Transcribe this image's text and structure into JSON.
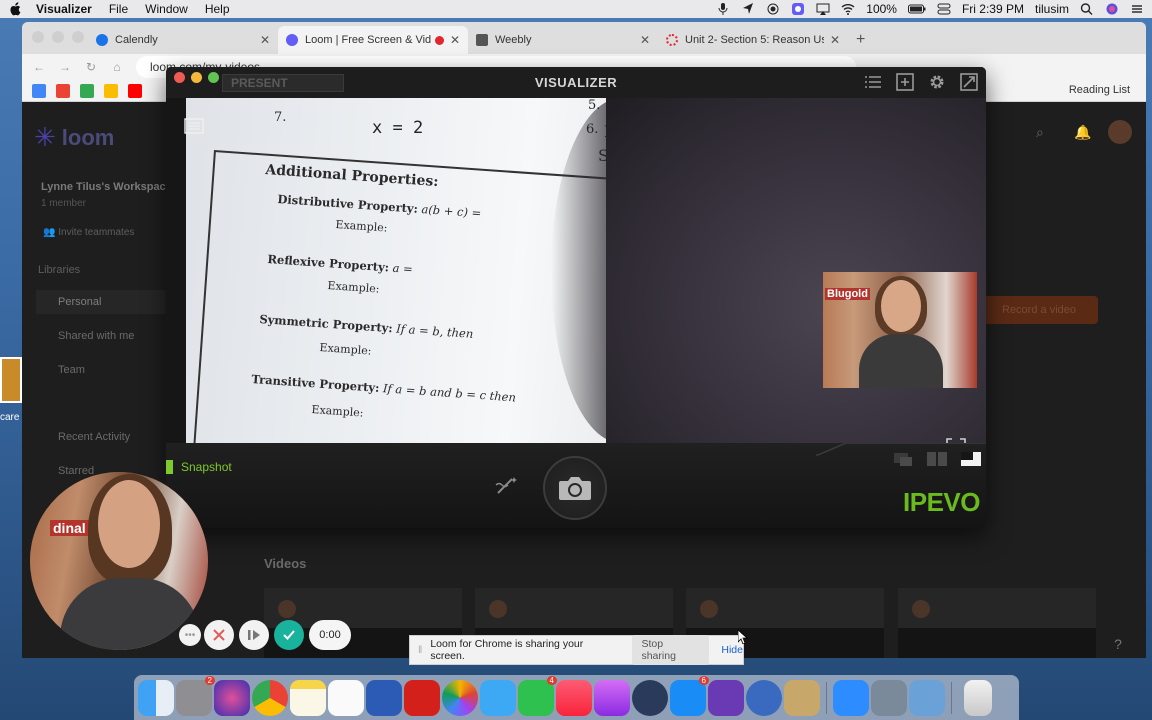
{
  "menubar": {
    "app": "Visualizer",
    "items": [
      "File",
      "Window",
      "Help"
    ],
    "battery": "100%",
    "clock": "Fri 2:39 PM",
    "user": "tilusim"
  },
  "browser": {
    "tabs": [
      {
        "label": "Calendly",
        "color": "#1a73e8"
      },
      {
        "label": "Loom | Free Screen & Vide",
        "color": "#625df5"
      },
      {
        "label": "Weebly",
        "color": "#333333"
      },
      {
        "label": "Unit 2- Section 5: Reason Usin",
        "color": "#e2262e"
      }
    ],
    "url": "loom.com/my-videos",
    "reading_list": "Reading List"
  },
  "loom": {
    "brand": "loom",
    "workspace": "Lynne Tilus's Workspace",
    "members": "1 member",
    "invite": "Invite teammates",
    "libraries": "Libraries",
    "nav": [
      "Personal",
      "Shared with me",
      "Team"
    ],
    "recent": "Recent Activity",
    "starred": "Starred",
    "record_btn": "Record a video",
    "videos_heading": "Videos",
    "help": "?"
  },
  "visualizer": {
    "mode": "PRESENT",
    "title": "VISUALIZER",
    "snapshot": "Snapshot",
    "brand": "IPEVO",
    "worksheet": {
      "line7": "7.",
      "answer": "x = 2",
      "heading": "Additional Properties:",
      "props": [
        {
          "name": "Distributive Property:",
          "formula": "a(b + c) ="
        },
        {
          "name": "Reflexive Property:",
          "formula": "a ="
        },
        {
          "name": "Symmetric Property:",
          "formula": "If a = b, then"
        },
        {
          "name": "Transitive Property:",
          "formula": "If a = b and b = c then"
        }
      ],
      "example": "Example:",
      "side_notes": [
        "5.",
        "6.",
        "D",
        "Su"
      ]
    },
    "pip_sign": "Blugold"
  },
  "recording": {
    "timer": "0:00",
    "bubble_sign": "dinal"
  },
  "share": {
    "message": "Loom for Chrome is sharing your screen.",
    "stop": "Stop sharing",
    "hide": "Hide"
  },
  "desktop": {
    "label": "care"
  },
  "dock_badges": {
    "system_prefs": "2",
    "facetime": "4",
    "appstore": "6"
  }
}
